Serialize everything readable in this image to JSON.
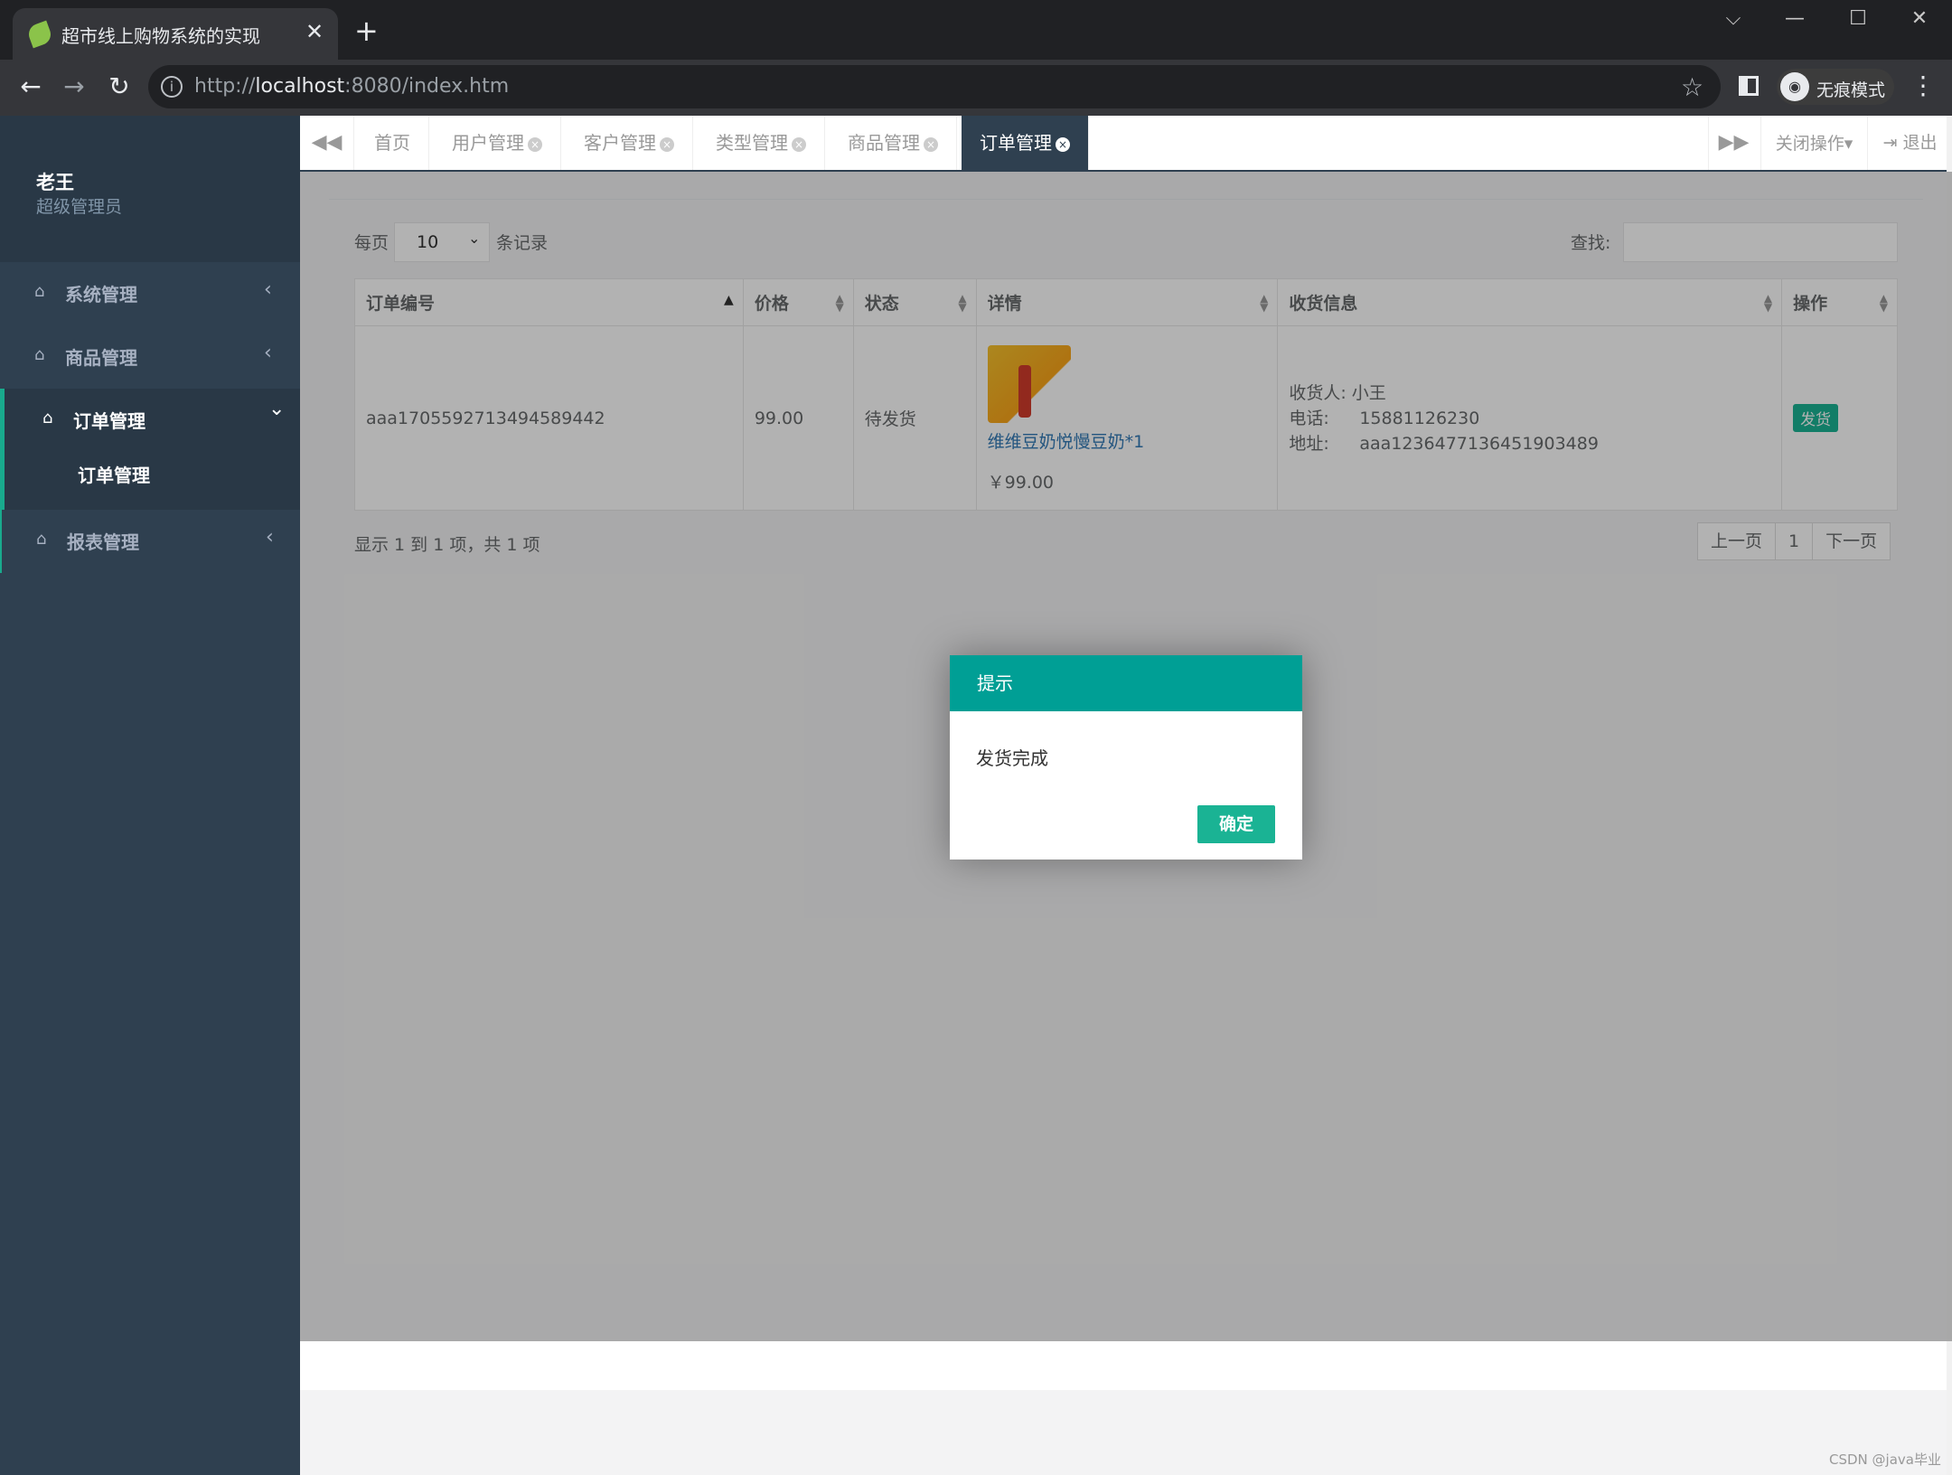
{
  "browser": {
    "tab_title": "超市线上购物系统的实现",
    "tab_close": "✕",
    "new_tab": "+",
    "url_prefix": "http://",
    "url_host": "localhost",
    "url_rest": ":8080/index.htm",
    "incognito_label": "无痕模式",
    "window_controls": [
      "⌵",
      "—",
      "☐",
      "✕"
    ]
  },
  "sidebar": {
    "user_name": "老王",
    "user_role": "超级管理员",
    "items": [
      {
        "label": "系统管理",
        "icon": "home-icon",
        "chevron": "‹"
      },
      {
        "label": "商品管理",
        "icon": "home-icon",
        "chevron": "‹"
      },
      {
        "label": "订单管理",
        "icon": "home-icon",
        "chevron": "⌄",
        "sub": "订单管理"
      },
      {
        "label": "报表管理",
        "icon": "home-icon",
        "chevron": "‹"
      }
    ]
  },
  "content_tabs": {
    "items": [
      "首页",
      "用户管理",
      "客户管理",
      "类型管理",
      "商品管理",
      "订单管理"
    ],
    "active": "订单管理",
    "close_ops": "关闭操作▾",
    "logout": "退出"
  },
  "table_controls": {
    "per_page_label": "每页",
    "page_size": "10",
    "records_label": "条记录",
    "search_label": "查找:"
  },
  "table": {
    "columns": [
      "订单编号",
      "价格",
      "状态",
      "详情",
      "收货信息",
      "操作"
    ],
    "rows": [
      {
        "order_no": "aaa1705592713494589442",
        "price": "99.00",
        "status": "待发货",
        "product_name": "维维豆奶悦慢豆奶*1",
        "product_price": "￥99.00",
        "receiver_label": "收货人:",
        "receiver": "小王",
        "phone_label": "电话:",
        "phone": "15881126230",
        "address_label": "地址:",
        "address": "aaa1236477136451903489",
        "action": "发货"
      }
    ]
  },
  "pagination": {
    "info": "显示 1 到 1 项，共 1 项",
    "prev": "上一页",
    "current": "1",
    "next": "下一页"
  },
  "dialog": {
    "title": "提示",
    "message": "发货完成",
    "ok": "确定"
  },
  "watermark": "CSDN @java毕业",
  "colors": {
    "sidebar_bg": "#2f4050",
    "accent": "#1ab394",
    "dialog_header": "#009f95",
    "link": "#337ab7"
  }
}
